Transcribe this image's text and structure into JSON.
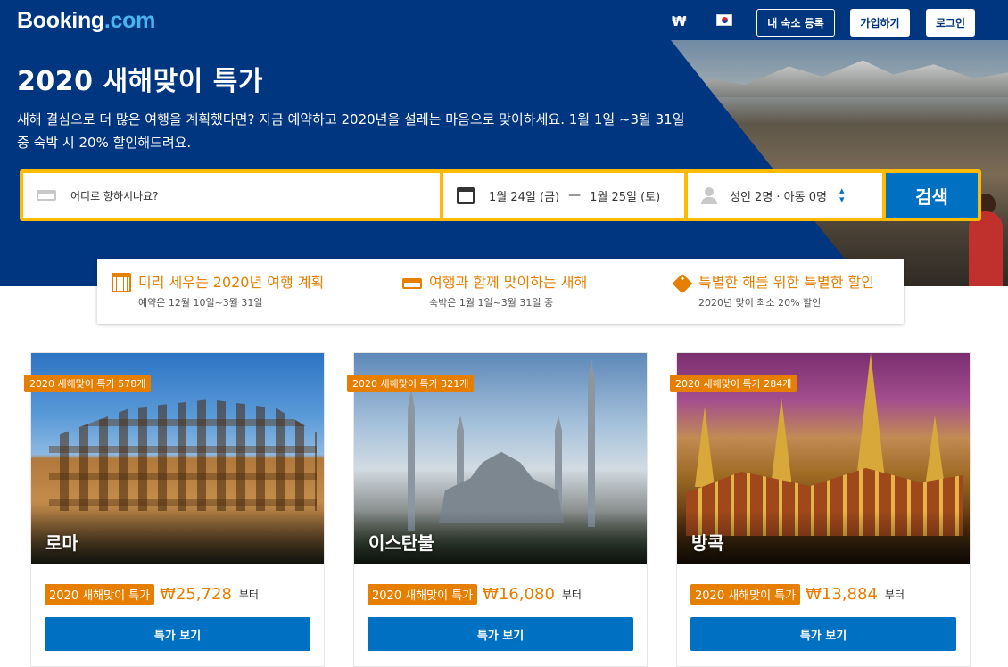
{
  "header": {
    "logo_main": "Booking",
    "logo_dot": ".com",
    "currency": "₩",
    "language_icon": "korean-flag-icon",
    "list_property": "내 숙소 등록",
    "register": "가입하기",
    "sign_in": "로그인"
  },
  "hero": {
    "title": "2020 새해맞이 특가",
    "description": "새해 결심으로 더 많은 여행을 계획했다면? 지금 예약하고 2020년을 설레는 마음으로 맞이하세요. 1월 1일 ~3월 31일 중 숙박 시 20% 할인해드려요."
  },
  "search": {
    "destination_placeholder": "어디로 향하시나요?",
    "checkin": "1월 24일 (금)",
    "dash": "—",
    "checkout": "1월 25일 (토)",
    "guests": "성인 2명 · 아동 0명",
    "button": "검색",
    "accent_color": "#febb02",
    "button_color": "#0071c2"
  },
  "benefits": [
    {
      "icon": "calendar-icon",
      "title": "미리 세우는 2020년 여행 계획",
      "subtitle": "예약은 12월 10일~3월 31일"
    },
    {
      "icon": "bed-icon",
      "title": "여행과 함께 맞이하는 새해",
      "subtitle": "숙박은 1월 1일~3월 31일 중"
    },
    {
      "icon": "tag-icon",
      "title": "특별한 해를 위한 특별한 할인",
      "subtitle": "2020년 맞이 최소 20% 할인"
    }
  ],
  "cards": [
    {
      "city": "로마",
      "badge": "2020 새해맞이 특가 578개",
      "price_badge": "2020 새해맞이 특가",
      "price": "₩25,728",
      "from": "부터",
      "button": "특가 보기"
    },
    {
      "city": "이스탄불",
      "badge": "2020 새해맞이 특가 321개",
      "price_badge": "2020 새해맞이 특가",
      "price": "₩16,080",
      "from": "부터",
      "button": "특가 보기"
    },
    {
      "city": "방콕",
      "badge": "2020 새해맞이 특가 284개",
      "price_badge": "2020 새해맞이 특가",
      "price": "₩13,884",
      "from": "부터",
      "button": "특가 보기"
    }
  ],
  "colors": {
    "brand": "#003580",
    "deal": "#e67e00",
    "primary": "#0071c2"
  }
}
